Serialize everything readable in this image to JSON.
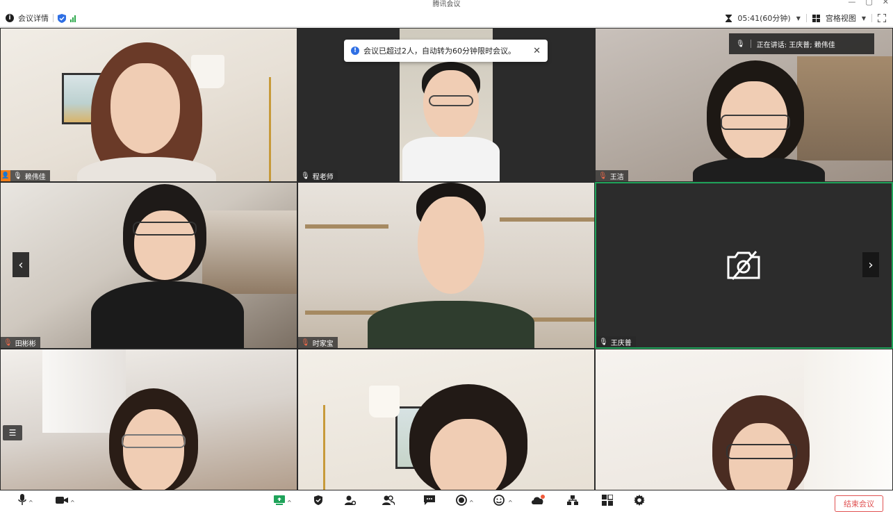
{
  "window": {
    "title": "腾讯会议",
    "controls": [
      "—",
      "▢",
      "✕"
    ]
  },
  "topbar": {
    "meeting_info": "会议详情",
    "timer": "05:41(60分钟)",
    "view_mode": "宫格视图"
  },
  "notice": {
    "text": "会议已超过2人，自动转为60分钟限时会议。",
    "close": "✕"
  },
  "speaking": {
    "text": "正在讲话:  王庆普; 赖伟佳"
  },
  "participants": [
    {
      "name": "赖伟佳",
      "is_host": true
    },
    {
      "name": "程老师"
    },
    {
      "name": "王洁"
    },
    {
      "name": "田彬彬"
    },
    {
      "name": "时家宝"
    },
    {
      "name": "王庆普",
      "camera_off": true,
      "active": true
    }
  ],
  "navigation": {
    "prev": "‹",
    "next": "›"
  },
  "bottombar": {
    "end_meeting": "结束会议"
  },
  "colors": {
    "active_border": "#1fa35a",
    "end_red": "#e05050",
    "notice_blue": "#2f6fe4",
    "host_orange": "#f07d1a"
  }
}
